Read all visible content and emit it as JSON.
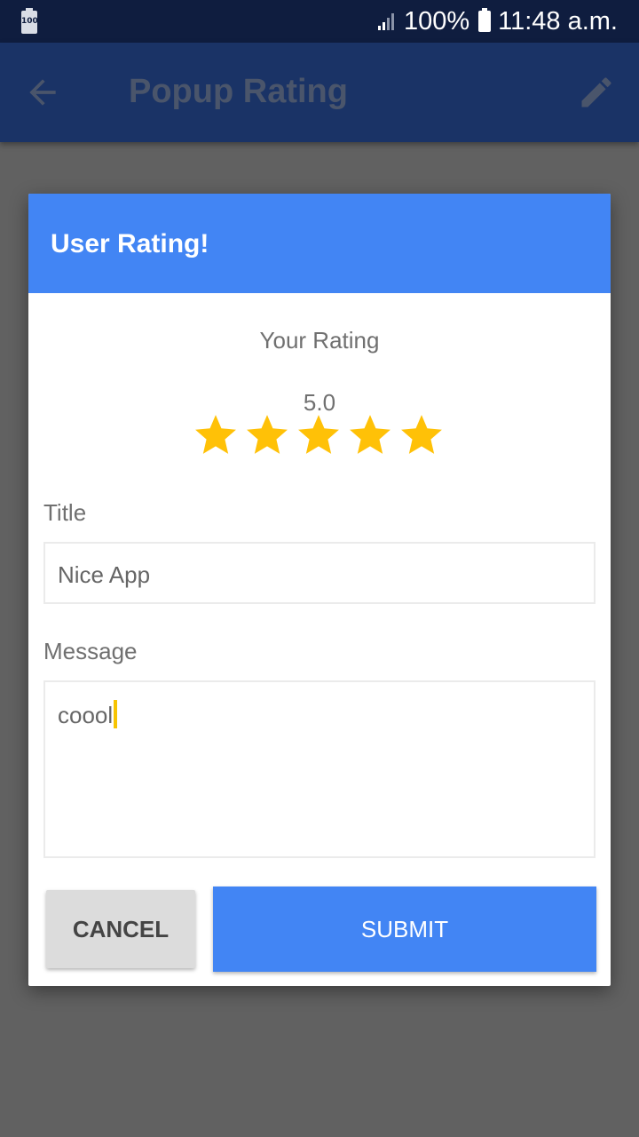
{
  "status_bar": {
    "small_battery_text": "100",
    "battery_percent": "100%",
    "time": "11:48 a.m."
  },
  "app_bar": {
    "title": "Popup Rating",
    "back_icon": "arrow-back-icon",
    "edit_icon": "pencil-icon"
  },
  "dialog": {
    "title": "User Rating!",
    "rating_label": "Your Rating",
    "rating_value": "5.0",
    "stars": {
      "filled": 5,
      "total": 5,
      "color": "#ffc107"
    },
    "title_field": {
      "label": "Title",
      "value": "Nice App"
    },
    "message_field": {
      "label": "Message",
      "value": "coool"
    },
    "cancel_label": "CANCEL",
    "submit_label": "SUBMIT"
  },
  "colors": {
    "header_blue": "#4285f4",
    "app_bar": "#1a3366",
    "status_bar": "#0f1d3f",
    "scrim": "#616161"
  }
}
